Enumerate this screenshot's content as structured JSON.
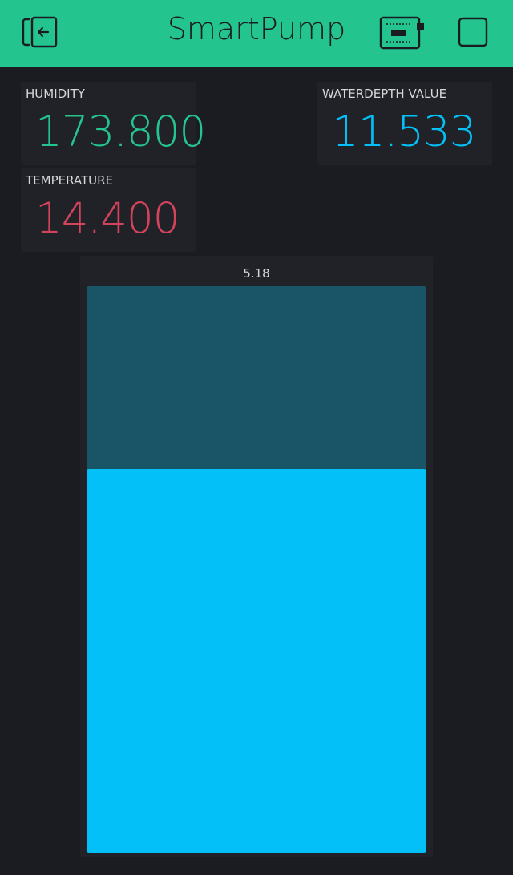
{
  "header": {
    "title": "SmartPump",
    "background_color": "#23c48e",
    "icons": {
      "exit": "exit-icon",
      "device": "device-board-icon",
      "square": "square-icon"
    }
  },
  "widgets": {
    "humidity": {
      "label": "HUMIDITY",
      "value": "173.800",
      "color": "#23c48e"
    },
    "temperature": {
      "label": "TEMPERATURE",
      "value": "14.400",
      "color": "#d3435c"
    },
    "waterdepth": {
      "label": "WATERDEPTH VALUE",
      "value": "11.533",
      "color": "#04c0f8"
    }
  },
  "level": {
    "value_label": "5.18",
    "fill_fraction": 0.677,
    "fill_color": "#04c0f8",
    "track_color": "#1a5467"
  }
}
